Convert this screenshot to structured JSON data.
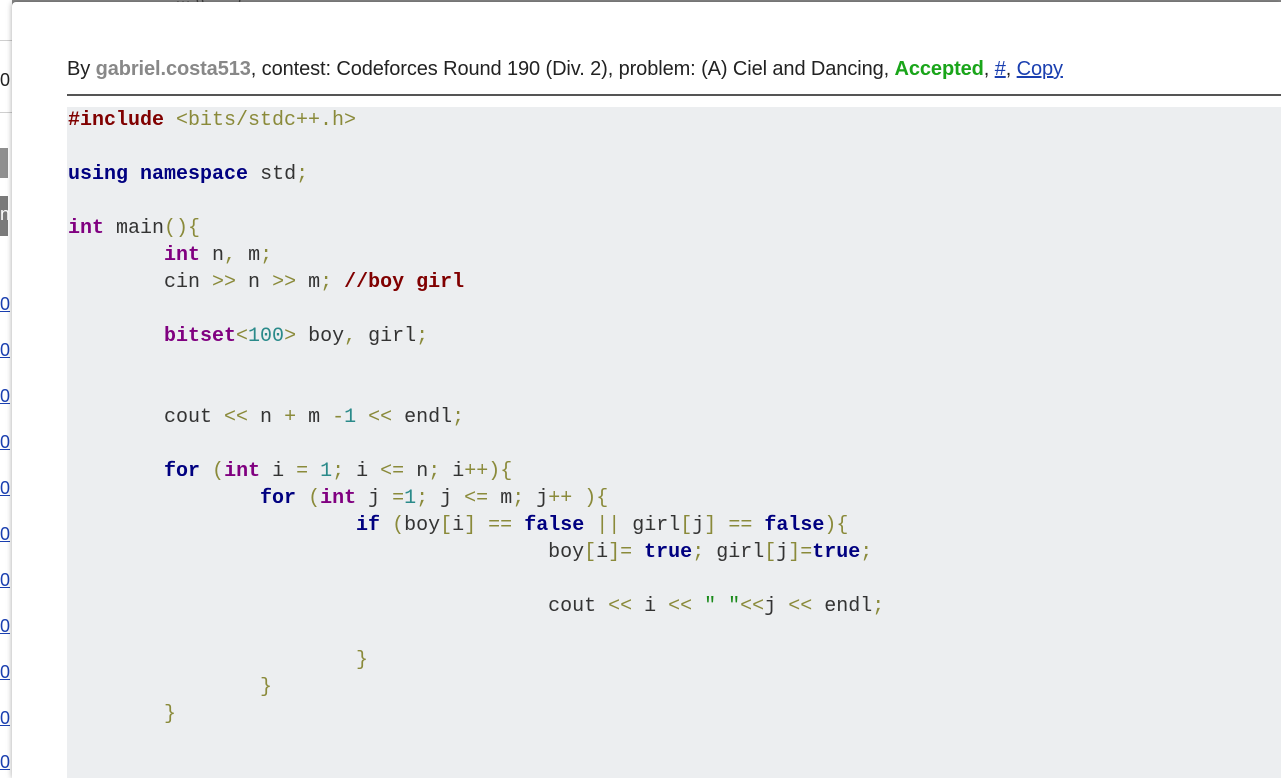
{
  "background": {
    "top_text": "… ((·· · ·) ·· ·",
    "left_stubs": [
      "0",
      "n",
      "0",
      "0",
      "0",
      "0",
      "0",
      "0",
      "0",
      "0",
      "0",
      "0",
      "0"
    ]
  },
  "header": {
    "by_label": "By ",
    "author": "gabriel.costa513",
    "contest_label": ", contest: ",
    "contest": "Codeforces Round 190 (Div. 2)",
    "problem_label": ", problem: ",
    "problem": "(A) Ciel and Dancing",
    "sep1": ", ",
    "verdict": "Accepted",
    "sep2": ", ",
    "hash_link": "#",
    "sep3": ", ",
    "copy_link": "Copy"
  },
  "colors": {
    "verdict": "#1aa51a",
    "author": "#888888",
    "link": "#1a3fb0",
    "code_bg": "#eceef0"
  },
  "code_lines": [
    [
      [
        "pp",
        "#include"
      ],
      [
        "id",
        " "
      ],
      [
        "op",
        "<bits/stdc++.h>"
      ]
    ],
    [],
    [
      [
        "kw",
        "using"
      ],
      [
        "id",
        " "
      ],
      [
        "kw",
        "namespace"
      ],
      [
        "id",
        " std"
      ],
      [
        "pu",
        ";"
      ]
    ],
    [],
    [
      [
        "ty",
        "int"
      ],
      [
        "id",
        " main"
      ],
      [
        "pu",
        "(){"
      ]
    ],
    [
      [
        "id",
        "        "
      ],
      [
        "ty",
        "int"
      ],
      [
        "id",
        " n"
      ],
      [
        "pu",
        ","
      ],
      [
        "id",
        " m"
      ],
      [
        "pu",
        ";"
      ]
    ],
    [
      [
        "id",
        "        cin "
      ],
      [
        "op",
        ">>"
      ],
      [
        "id",
        " n "
      ],
      [
        "op",
        ">>"
      ],
      [
        "id",
        " m"
      ],
      [
        "pu",
        ";"
      ],
      [
        "id",
        " "
      ],
      [
        "cm",
        "//boy girl"
      ]
    ],
    [],
    [
      [
        "id",
        "        "
      ],
      [
        "ty",
        "bitset"
      ],
      [
        "op",
        "<"
      ],
      [
        "nm",
        "100"
      ],
      [
        "op",
        ">"
      ],
      [
        "id",
        " boy"
      ],
      [
        "pu",
        ","
      ],
      [
        "id",
        " girl"
      ],
      [
        "pu",
        ";"
      ]
    ],
    [],
    [],
    [
      [
        "id",
        "        cout "
      ],
      [
        "op",
        "<<"
      ],
      [
        "id",
        " n "
      ],
      [
        "op",
        "+"
      ],
      [
        "id",
        " m "
      ],
      [
        "op",
        "-"
      ],
      [
        "nm",
        "1"
      ],
      [
        "id",
        " "
      ],
      [
        "op",
        "<<"
      ],
      [
        "id",
        " endl"
      ],
      [
        "pu",
        ";"
      ]
    ],
    [],
    [
      [
        "id",
        "        "
      ],
      [
        "kw",
        "for"
      ],
      [
        "id",
        " "
      ],
      [
        "pu",
        "("
      ],
      [
        "ty",
        "int"
      ],
      [
        "id",
        " i "
      ],
      [
        "op",
        "="
      ],
      [
        "id",
        " "
      ],
      [
        "nm",
        "1"
      ],
      [
        "pu",
        ";"
      ],
      [
        "id",
        " i "
      ],
      [
        "op",
        "<="
      ],
      [
        "id",
        " n"
      ],
      [
        "pu",
        ";"
      ],
      [
        "id",
        " i"
      ],
      [
        "op",
        "++"
      ],
      [
        "pu",
        "){"
      ]
    ],
    [
      [
        "id",
        "                "
      ],
      [
        "kw",
        "for"
      ],
      [
        "id",
        " "
      ],
      [
        "pu",
        "("
      ],
      [
        "ty",
        "int"
      ],
      [
        "id",
        " j "
      ],
      [
        "op",
        "="
      ],
      [
        "nm",
        "1"
      ],
      [
        "pu",
        ";"
      ],
      [
        "id",
        " j "
      ],
      [
        "op",
        "<="
      ],
      [
        "id",
        " m"
      ],
      [
        "pu",
        ";"
      ],
      [
        "id",
        " j"
      ],
      [
        "op",
        "++"
      ],
      [
        "id",
        " "
      ],
      [
        "pu",
        "){"
      ]
    ],
    [
      [
        "id",
        "                        "
      ],
      [
        "kw",
        "if"
      ],
      [
        "id",
        " "
      ],
      [
        "pu",
        "("
      ],
      [
        "id",
        "boy"
      ],
      [
        "pu",
        "["
      ],
      [
        "id",
        "i"
      ],
      [
        "pu",
        "]"
      ],
      [
        "id",
        " "
      ],
      [
        "op",
        "=="
      ],
      [
        "id",
        " "
      ],
      [
        "kw",
        "false"
      ],
      [
        "id",
        " "
      ],
      [
        "op",
        "||"
      ],
      [
        "id",
        " girl"
      ],
      [
        "pu",
        "["
      ],
      [
        "id",
        "j"
      ],
      [
        "pu",
        "]"
      ],
      [
        "id",
        " "
      ],
      [
        "op",
        "=="
      ],
      [
        "id",
        " "
      ],
      [
        "kw",
        "false"
      ],
      [
        "pu",
        "){"
      ]
    ],
    [
      [
        "id",
        "                                        boy"
      ],
      [
        "pu",
        "["
      ],
      [
        "id",
        "i"
      ],
      [
        "pu",
        "]"
      ],
      [
        "op",
        "="
      ],
      [
        "id",
        " "
      ],
      [
        "kw",
        "true"
      ],
      [
        "pu",
        ";"
      ],
      [
        "id",
        " girl"
      ],
      [
        "pu",
        "["
      ],
      [
        "id",
        "j"
      ],
      [
        "pu",
        "]"
      ],
      [
        "op",
        "="
      ],
      [
        "kw",
        "true"
      ],
      [
        "pu",
        ";"
      ]
    ],
    [],
    [
      [
        "id",
        "                                        cout "
      ],
      [
        "op",
        "<<"
      ],
      [
        "id",
        " i "
      ],
      [
        "op",
        "<<"
      ],
      [
        "id",
        " "
      ],
      [
        "st",
        "\" \""
      ],
      [
        "op",
        "<<"
      ],
      [
        "id",
        "j "
      ],
      [
        "op",
        "<<"
      ],
      [
        "id",
        " endl"
      ],
      [
        "pu",
        ";"
      ]
    ],
    [],
    [
      [
        "id",
        "                        "
      ],
      [
        "pu",
        "}"
      ]
    ],
    [
      [
        "id",
        "                "
      ],
      [
        "pu",
        "}"
      ]
    ],
    [
      [
        "id",
        "        "
      ],
      [
        "pu",
        "}"
      ]
    ]
  ]
}
